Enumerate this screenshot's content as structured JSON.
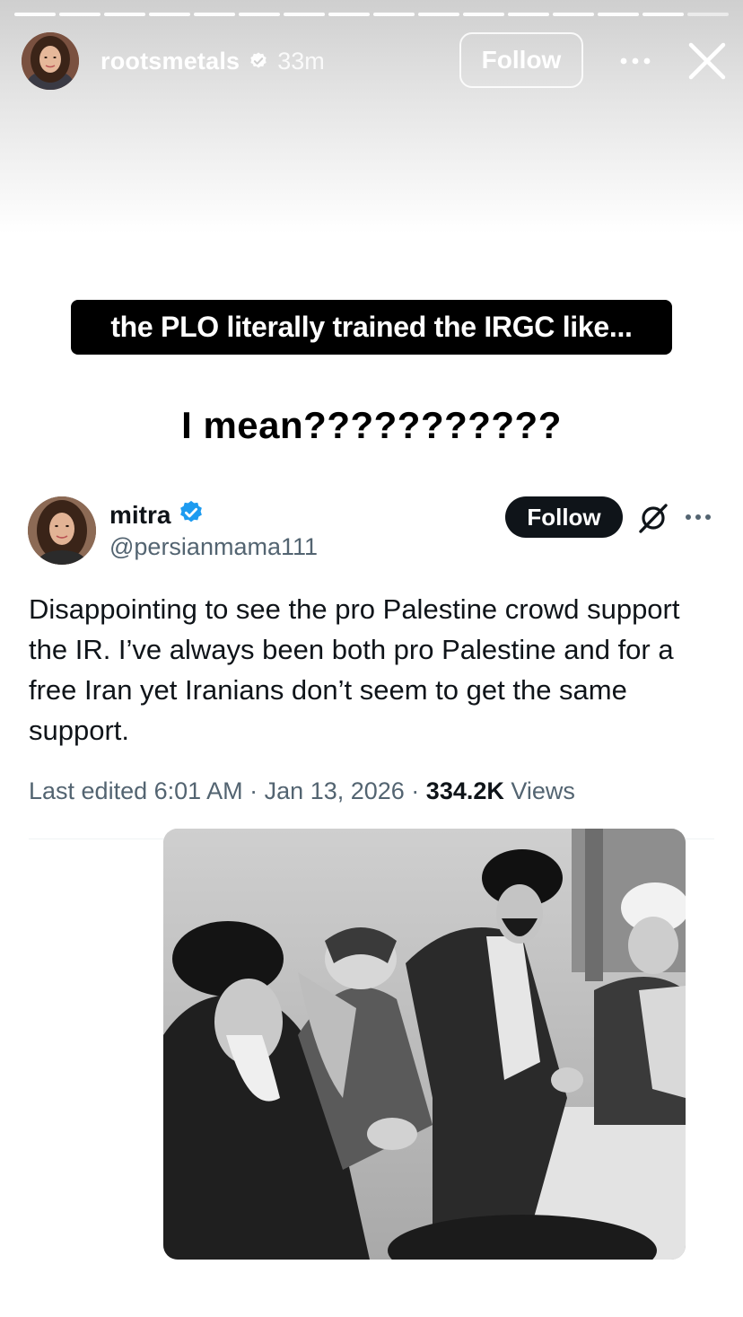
{
  "story": {
    "progress_segments": 16,
    "username": "rootsmetals",
    "time_ago": "33m",
    "follow_label": "Follow",
    "more_icon": "more-horizontal-icon",
    "close_icon": "close-icon",
    "verified_icon": "verified-badge-icon"
  },
  "captions": {
    "box_text": "the PLO literally trained the IRGC like...",
    "second_text": "I mean???????????"
  },
  "tweet": {
    "display_name": "mitra",
    "handle": "@persianmama111",
    "follow_label": "Follow",
    "grok_icon": "grok-icon",
    "more_icon": "more-horizontal-icon",
    "text": "Disappointing to see the pro Palestine crowd support the IR. I’ve always been both pro Palestine and for a free Iran yet Iranians don’t seem to get the same support.",
    "meta": {
      "edited": "Last edited 6:01 AM · Jan 13, 2026 · ",
      "views_count": "334.2K",
      "views_label": " Views"
    },
    "verified_color": "#1d9bf0"
  },
  "colors": {
    "tweet_follow_bg": "#0f1419",
    "caption_box_bg": "#000000",
    "muted_text": "#536471"
  }
}
